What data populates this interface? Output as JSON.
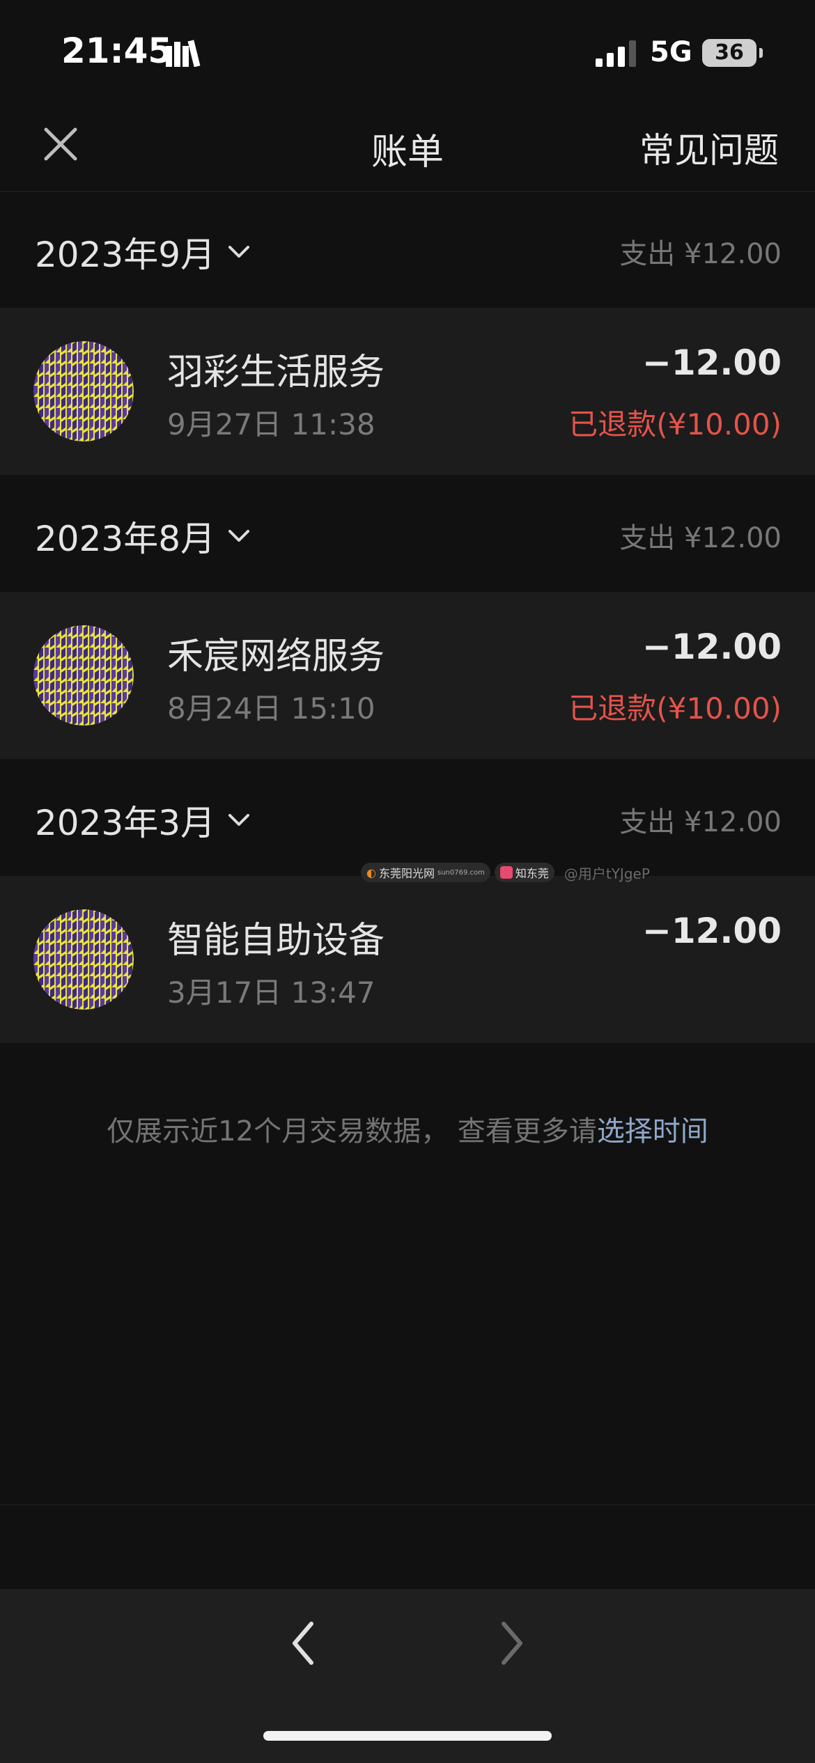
{
  "status_bar": {
    "time": "21:45",
    "network": "5G",
    "battery": "36",
    "icons": [
      "books-icon",
      "signal-icon",
      "battery-icon"
    ]
  },
  "nav": {
    "title": "账单",
    "right_action": "常见问题",
    "left_icon": "close-icon"
  },
  "months": [
    {
      "label": "2023年9月",
      "spend": "支出 ¥12.00",
      "transactions": [
        {
          "name": "羽彩生活服务",
          "time": "9月27日 11:38",
          "amount": "−12.00",
          "refund": "已退款(¥10.00)"
        }
      ]
    },
    {
      "label": "2023年8月",
      "spend": "支出 ¥12.00",
      "transactions": [
        {
          "name": "禾宸网络服务",
          "time": "8月24日 15:10",
          "amount": "−12.00",
          "refund": "已退款(¥10.00)"
        }
      ]
    },
    {
      "label": "2023年3月",
      "spend": "支出 ¥12.00",
      "transactions": [
        {
          "name": "智能自助设备",
          "time": "3月17日 13:47",
          "amount": "−12.00",
          "refund": ""
        }
      ]
    }
  ],
  "watermark": {
    "site": "东莞阳光网",
    "domain": "sun0769.com",
    "app": "知东莞",
    "user": "@用户tYJgeP"
  },
  "footer": {
    "note": "仅展示近12个月交易数据， 查看更多请",
    "link": "选择时间"
  },
  "toolbar": {
    "back_icon": "chevron-left-icon",
    "forward_icon": "chevron-right-icon"
  },
  "colors": {
    "background": "#111111",
    "row_background": "#1c1c1c",
    "refund": "#e5534b",
    "link": "#8fa7c9",
    "avatar_yellow": "#e8e43a",
    "avatar_purple": "#5b3aa0"
  }
}
